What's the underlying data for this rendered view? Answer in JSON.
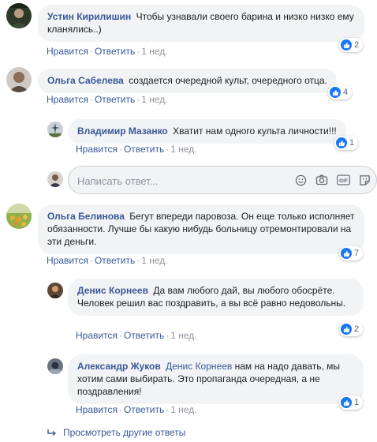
{
  "comments": [
    {
      "author": "Устин Кирилишин",
      "text": "Чтобы узнавали своего барина и низко низко ему кланялись..)",
      "like": "Нравится",
      "reply": "Ответить",
      "time": "1 нед.",
      "reactions": "2"
    },
    {
      "author": "Ольга Сабелева",
      "text": "создается очередной культ, очередного отца.",
      "like": "Нравится",
      "reply": "Ответить",
      "time": "1 нед.",
      "reactions": "4"
    },
    {
      "author": "Владимир Мазанко",
      "text": "Хватит нам одного культа личности!!!",
      "like": "Нравится",
      "reply": "Ответить",
      "time": "1 нед.",
      "reactions": "1"
    },
    {
      "author": "Ольга Белинова",
      "text": "Бегут впереди паровоза. Он еще только исполняет обязанности. Лучше бы какую нибудь больницу отремонтировали на эти деньги.",
      "like": "Нравится",
      "reply": "Ответить",
      "time": "1 нед.",
      "reactions": "7"
    },
    {
      "author": "Денис Корнеев",
      "text": "Да вам любого дай, вы любого обосрёте. Человек решил вас поздравить, а вы всё равно недовольны.",
      "like": "Нравится",
      "reply": "Ответить",
      "time": "1 нед.",
      "reactions": "2"
    },
    {
      "author": "Александр Жуков",
      "mention": "Денис Корнеев",
      "text": "нам на надо давать, мы хотим сами выбирать. Это пропаганда очередная, а не поздравления!",
      "like": "Нравится",
      "reply": "Ответить",
      "time": "1 нед.",
      "reactions": "1"
    }
  ],
  "composer": {
    "placeholder": "Написать ответ...",
    "icons": [
      "emoji-icon",
      "camera-icon",
      "gif-icon",
      "sticker-icon"
    ]
  },
  "more_replies": "Просмотреть другие ответы",
  "colors": {
    "link": "#385898",
    "bubble": "#f2f3f5",
    "like_blue": "#1877f2",
    "meta_gray": "#90949c"
  }
}
